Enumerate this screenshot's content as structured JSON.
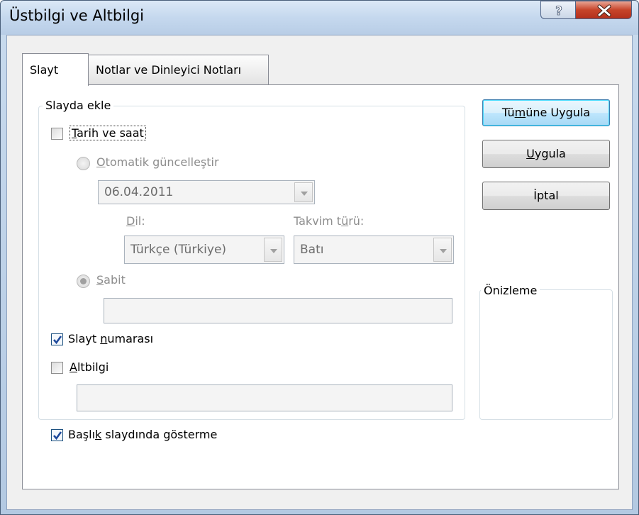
{
  "window": {
    "title": "Üstbilgi ve Altbilgi"
  },
  "tabs": [
    {
      "label": "Slayt",
      "active": true
    },
    {
      "label": "Notlar ve Dinleyici Notları",
      "active": false
    }
  ],
  "slide_group": {
    "label": "Slayda ekle",
    "date_time": {
      "label": "Tarih ve saat",
      "mnemonic": "T",
      "rest": "arih ve saat",
      "checked": false
    },
    "auto_update": {
      "pre": "",
      "mnemonic": "O",
      "rest": "tomatik güncelleştir",
      "selected": false,
      "enabled": false
    },
    "date_value": "06.04.2011",
    "language": {
      "label_mnemonic": "D",
      "label_rest": "il:",
      "value": "Türkçe (Türkiye)"
    },
    "calendar": {
      "label_pre": "Takvim t",
      "label_mnemonic": "ü",
      "label_rest": "rü:",
      "value": "Batı"
    },
    "fixed": {
      "mnemonic": "S",
      "rest": "abit",
      "selected": true,
      "enabled": false,
      "value": ""
    },
    "slide_number": {
      "pre": "Slayt ",
      "mnemonic": "n",
      "rest": "umarası",
      "checked": true
    },
    "footer": {
      "mnemonic": "A",
      "rest": "ltbilgi",
      "checked": false,
      "value": ""
    }
  },
  "title_slide_option": {
    "pre": "Başlı",
    "mnemonic": "k",
    "rest": " slaydında gösterme",
    "checked": true
  },
  "buttons": {
    "apply_all": {
      "pre": "Tü",
      "mnemonic": "m",
      "rest": "üne Uygula"
    },
    "apply": {
      "pre": "",
      "mnemonic": "U",
      "rest": "ygula"
    },
    "cancel": "İptal"
  },
  "preview": {
    "label": "Önizleme"
  },
  "colors": {
    "accent": "#3c7fb1",
    "title_bar": "#c5d8ee",
    "close": "#c7442a"
  }
}
